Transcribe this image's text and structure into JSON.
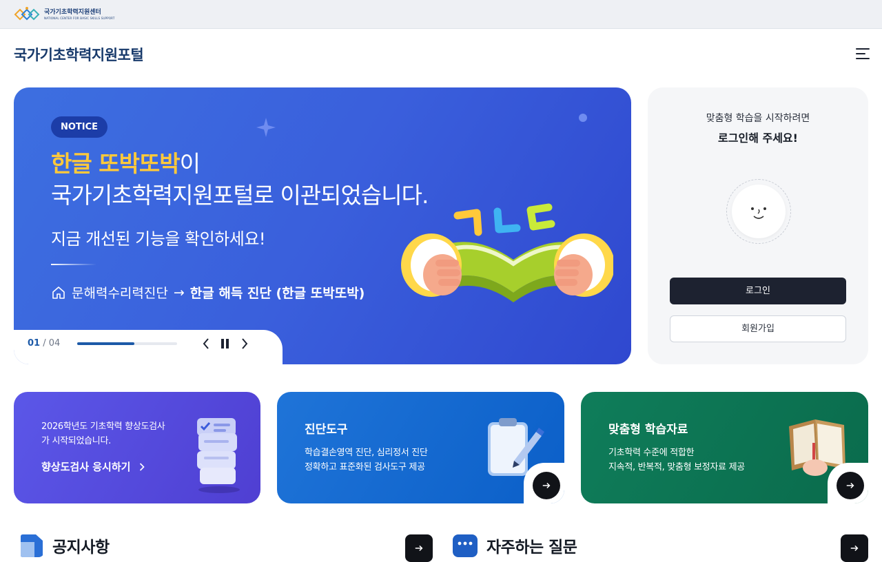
{
  "topbar": {
    "logo_ko": "국가기초학력지원센터",
    "logo_en": "NATIONAL CENTER FOR BASIC SKILLS SUPPORT"
  },
  "header": {
    "site_title": "국가기초학력지원포털"
  },
  "hero": {
    "badge": "NOTICE",
    "headline_highlight": "한글 또박또박",
    "headline_rest1": "이",
    "headline_line2": "국가기초학력지원포털로 이관되었습니다.",
    "subline": "지금 개선된 기능을 확인하세요!",
    "path_from": "문해력수리력진단",
    "path_arrow": "→",
    "path_to": "한글 해득 진단 (한글 또박또박)",
    "slide_current": "01",
    "slide_sep": " / ",
    "slide_total": "04",
    "progress_fraction": 0.57
  },
  "login_panel": {
    "line1": "맞춤형 학습을 시작하려면",
    "line2": "로그인해 주세요!",
    "login_button": "로그인",
    "join_button": "회원가입"
  },
  "cards": [
    {
      "text": "2026학년도 기초학력 향상도검사가 시작되었습니다.",
      "link": "향상도검사 응시하기"
    },
    {
      "title": "진단도구",
      "desc1": "학습결손영역 진단, 심리정서 진단",
      "desc2": "정확하고 표준화된 검사도구 제공"
    },
    {
      "title": "맞춤형 학습자료",
      "desc1": "기초학력 수준에 적합한",
      "desc2": "지속적, 반복적, 맞춤형 보정자료 제공"
    }
  ],
  "sections": {
    "notice_title": "공지사항",
    "faq_title": "자주하는 질문"
  },
  "colors": {
    "brand_navy": "#183a6b",
    "hero_blue": "#3a5fdc",
    "highlight_yellow": "#ffc93a",
    "card_purple": "#5248dc",
    "card_blue": "#1a6ed4",
    "card_green": "#0e7654"
  }
}
